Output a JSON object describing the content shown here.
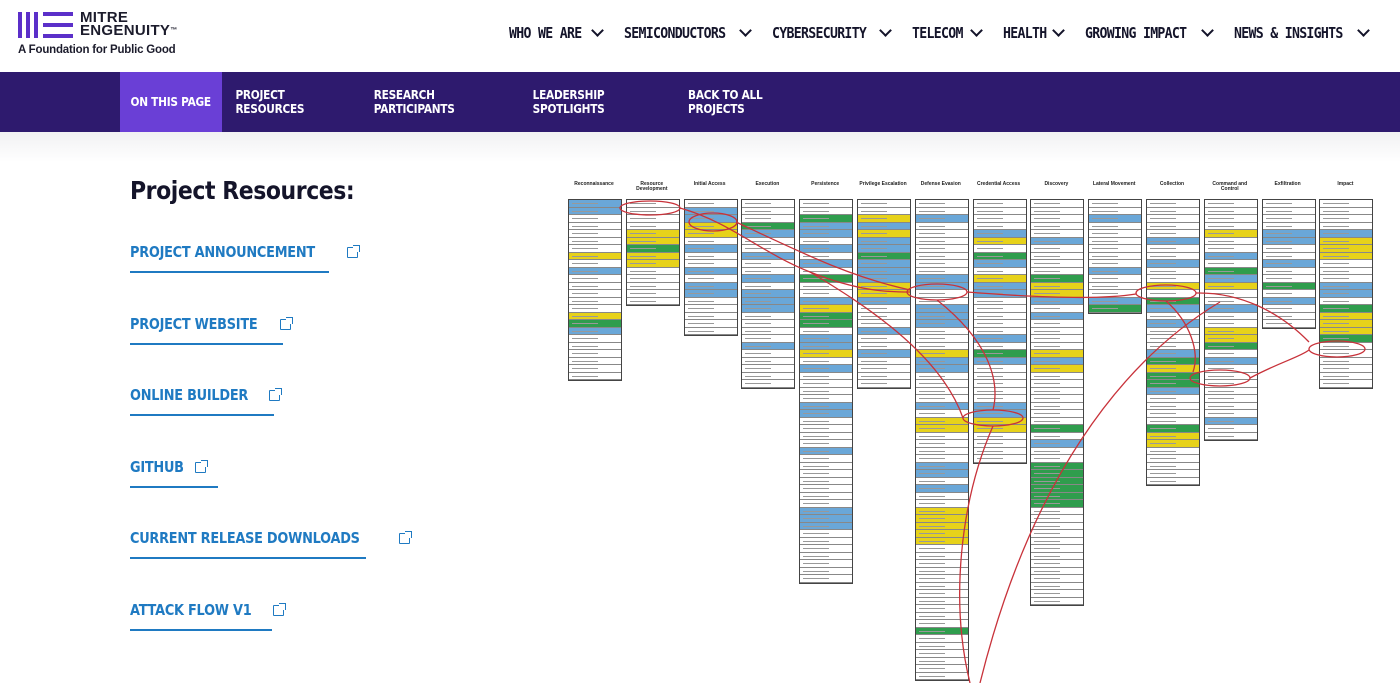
{
  "brand": {
    "name_line1": "MITRE",
    "name_line2": "ENGENUITY",
    "tm": "™",
    "tagline": "A Foundation for Public Good"
  },
  "main_nav": [
    {
      "label": "WHO WE ARE"
    },
    {
      "label": "SEMICONDUCTORS"
    },
    {
      "label": "CYBERSECURITY"
    },
    {
      "label": "TELECOM"
    },
    {
      "label": "HEALTH"
    },
    {
      "label": "GROWING IMPACT"
    },
    {
      "label": "NEWS & INSIGHTS"
    }
  ],
  "sub_nav": [
    {
      "label": "ON THIS PAGE",
      "active": true
    },
    {
      "label": "PROJECT RESOURCES"
    },
    {
      "label": "RESEARCH PARTICIPANTS"
    },
    {
      "label": "LEADERSHIP SPOTLIGHTS"
    },
    {
      "label": "BACK TO ALL PROJECTS"
    }
  ],
  "resources": {
    "title": "Project Resources:",
    "links": [
      {
        "label": "PROJECT ANNOUNCEMENT"
      },
      {
        "label": "PROJECT WEBSITE"
      },
      {
        "label": "ONLINE BUILDER"
      },
      {
        "label": "GITHUB"
      },
      {
        "label": "CURRENT RELEASE DOWNLOADS"
      },
      {
        "label": "ATTACK FLOW V1"
      }
    ]
  },
  "matrix": {
    "tactics": [
      {
        "name": "Reconnaissance",
        "pattern": "bbwwwwwywbwwwwwygbwwwwww"
      },
      {
        "name": "Resource Development",
        "pattern": "wwwwyygyywwwww"
      },
      {
        "name": "Initial Access",
        "pattern": "wbbyywbwwbwbbwwwww"
      },
      {
        "name": "Execution",
        "pattern": "wwwgbwwbwwbwbbbwwwwbwwwww"
      },
      {
        "name": "Persistence",
        "pattern": "wwgbbwbwbwgwwbyggwbbywbwwwwbbwwwwbwwwwwwwbbbwwwwwww"
      },
      {
        "name": "Privilege Escalation",
        "pattern": "wwybybbgbbbyybwwwbwwbwwww"
      },
      {
        "name": "Defense Evasion",
        "pattern": "wwbwwwwwwwbbwwbbbwwwybbwwwwbwyywwwwbbwbwwyyyyywwwwwwwwwwwgwwwwwwwwww"
      },
      {
        "name": "Credential Access",
        "pattern": "wwwwbywgbwybbwwwwwbwgbwwwwwbbyywwww"
      },
      {
        "name": "Discovery",
        "pattern": "wwwwwbwwwwgyybwbwwwwybywwwwwwwgwbwwggggggwwwwwwwwwwwww"
      },
      {
        "name": "Lateral Movement",
        "pattern": "wwbwwwwwwbwwwbg"
      },
      {
        "name": "Collection",
        "pattern": "wwwwwbwwbwwywgbwbwwwbgyggbwwwwgyywwwww"
      },
      {
        "name": "Command and Control",
        "pattern": "wwwwywwbwgbywwbwwyygwbwwwwwwwbww"
      },
      {
        "name": "Exfiltration",
        "pattern": "wwwwbbwwbwwgwbwww"
      },
      {
        "name": "Impact",
        "pattern": "wwwwbyyywwwbbwgyyygwwwwww"
      }
    ]
  }
}
